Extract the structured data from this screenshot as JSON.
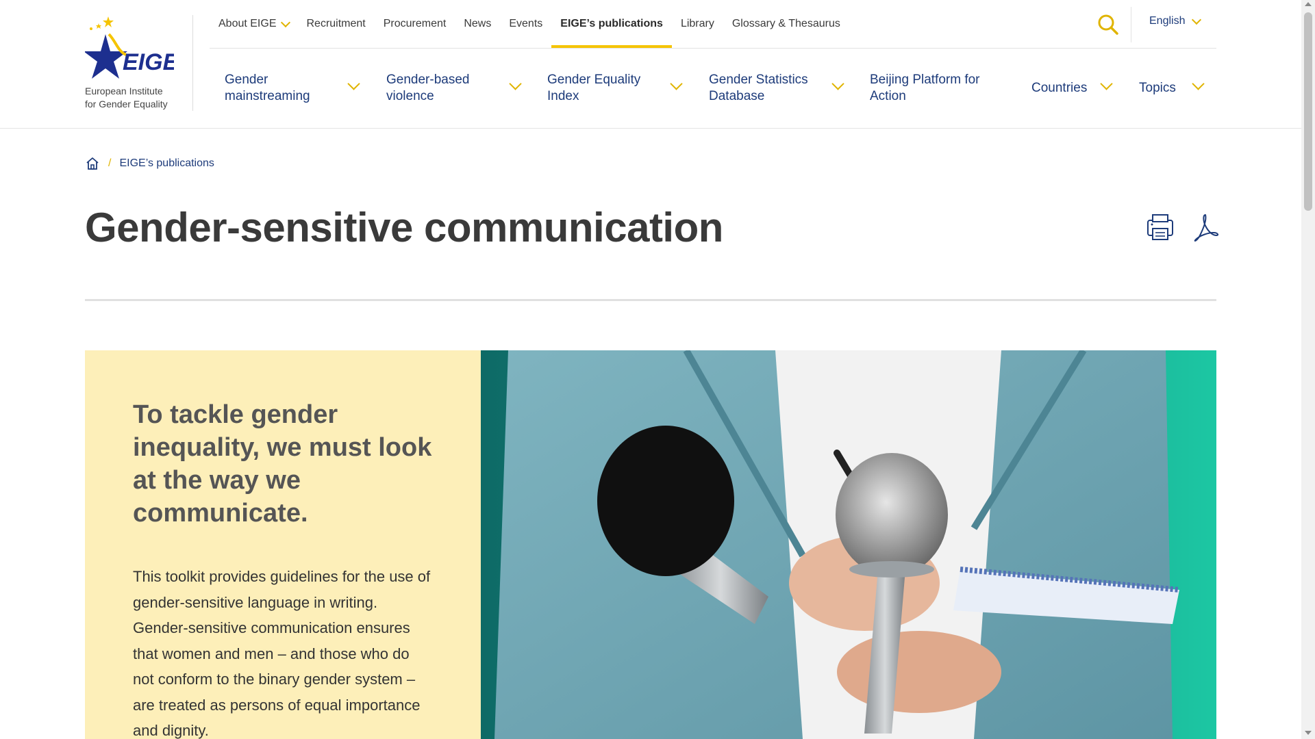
{
  "logo": {
    "wordmark": "EIGE",
    "line1": "European Institute",
    "line2": "for Gender Equality"
  },
  "topnav": {
    "items": [
      {
        "label": "About EIGE",
        "dropdown": true
      },
      {
        "label": "Recruitment"
      },
      {
        "label": "Procurement"
      },
      {
        "label": "News"
      },
      {
        "label": "Events"
      },
      {
        "label": "EIGE’s publications",
        "active": true
      },
      {
        "label": "Library"
      },
      {
        "label": "Glossary & Thesaurus"
      }
    ]
  },
  "language": {
    "label": "English"
  },
  "mainnav": {
    "items": [
      {
        "line1": "Gender",
        "line2": "mainstreaming"
      },
      {
        "line1": "Gender-based",
        "line2": "violence"
      },
      {
        "line1": "Gender Equality",
        "line2": "Index"
      },
      {
        "line1": "Gender Statistics",
        "line2": "Database"
      },
      {
        "line1": "Beijing Platform for",
        "line2": "Action"
      },
      {
        "line1": "Countries",
        "line2": ""
      },
      {
        "line1": "Topics",
        "line2": ""
      }
    ]
  },
  "breadcrumb": {
    "separator": "/",
    "current": "EIGE’s publications"
  },
  "page": {
    "title": "Gender-sensitive communication"
  },
  "hero": {
    "lead": "To tackle gender inequality, we must look at the way we communicate.",
    "body": "This toolkit provides guidelines for the use of gender-sensitive language in writing. Gender-sensitive communication ensures that women and men – and those who do not conform to the binary gender system – are treated as persons of equal importance and dignity."
  },
  "colors": {
    "brand_navy": "#1d3b7a",
    "accent_yellow": "#f5c400",
    "hero_panel": "#fdefb9",
    "hero_teal": "#14a99a"
  },
  "icons": {
    "home": "home-icon",
    "search": "search-icon",
    "print": "print-icon",
    "pdf": "pdf-icon",
    "chevron": "chevron-down-icon"
  }
}
